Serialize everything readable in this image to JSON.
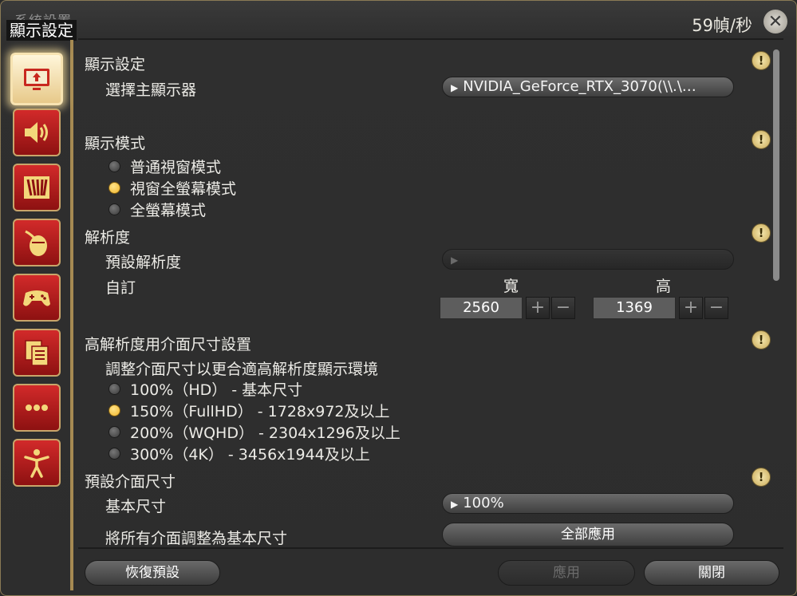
{
  "window": {
    "title_ghost": "系統設置",
    "title": "顯示設定",
    "fps": "59幀/秒"
  },
  "sidebar": {
    "items": [
      {
        "icon": "monitor-icon",
        "active": true
      },
      {
        "icon": "speaker-icon",
        "active": false
      },
      {
        "icon": "window-blinds-icon",
        "active": false
      },
      {
        "icon": "mouse-icon",
        "active": false
      },
      {
        "icon": "gamepad-icon",
        "active": false
      },
      {
        "icon": "documents-icon",
        "active": false
      },
      {
        "icon": "more-icon",
        "active": false
      },
      {
        "icon": "accessibility-icon",
        "active": false
      }
    ]
  },
  "display": {
    "title": "顯示設定",
    "monitor_label": "選擇主顯示器",
    "monitor_value": "NVIDIA_GeForce_RTX_3070(\\\\.\\…"
  },
  "mode": {
    "title": "顯示模式",
    "options": [
      "普通視窗模式",
      "視窗全螢幕模式",
      "全螢幕模式"
    ],
    "selected": 1
  },
  "resolution": {
    "title": "解析度",
    "preset_label": "預設解析度",
    "preset_value": "",
    "custom_label": "自訂",
    "width_label": "寬",
    "height_label": "高",
    "width": "2560",
    "height": "1369",
    "plus": "+",
    "minus": "−"
  },
  "hires": {
    "title": "高解析度用介面尺寸設置",
    "description": "調整介面尺寸以更合適高解析度顯示環境",
    "options": [
      "100%（HD） - 基本尺寸",
      "150%（FullHD） - 1728x972及以上",
      "200%（WQHD） - 2304x1296及以上",
      "300%（4K） - 3456x1944及以上"
    ],
    "selected": 1
  },
  "ui_size": {
    "title": "預設介面尺寸",
    "base_label": "基本尺寸",
    "base_value": "100%",
    "apply_label": "將所有介面調整為基本尺寸",
    "apply_button": "全部應用"
  },
  "footer": {
    "reset": "恢復預設",
    "apply": "應用",
    "close": "關閉"
  },
  "warn_icon": "!"
}
